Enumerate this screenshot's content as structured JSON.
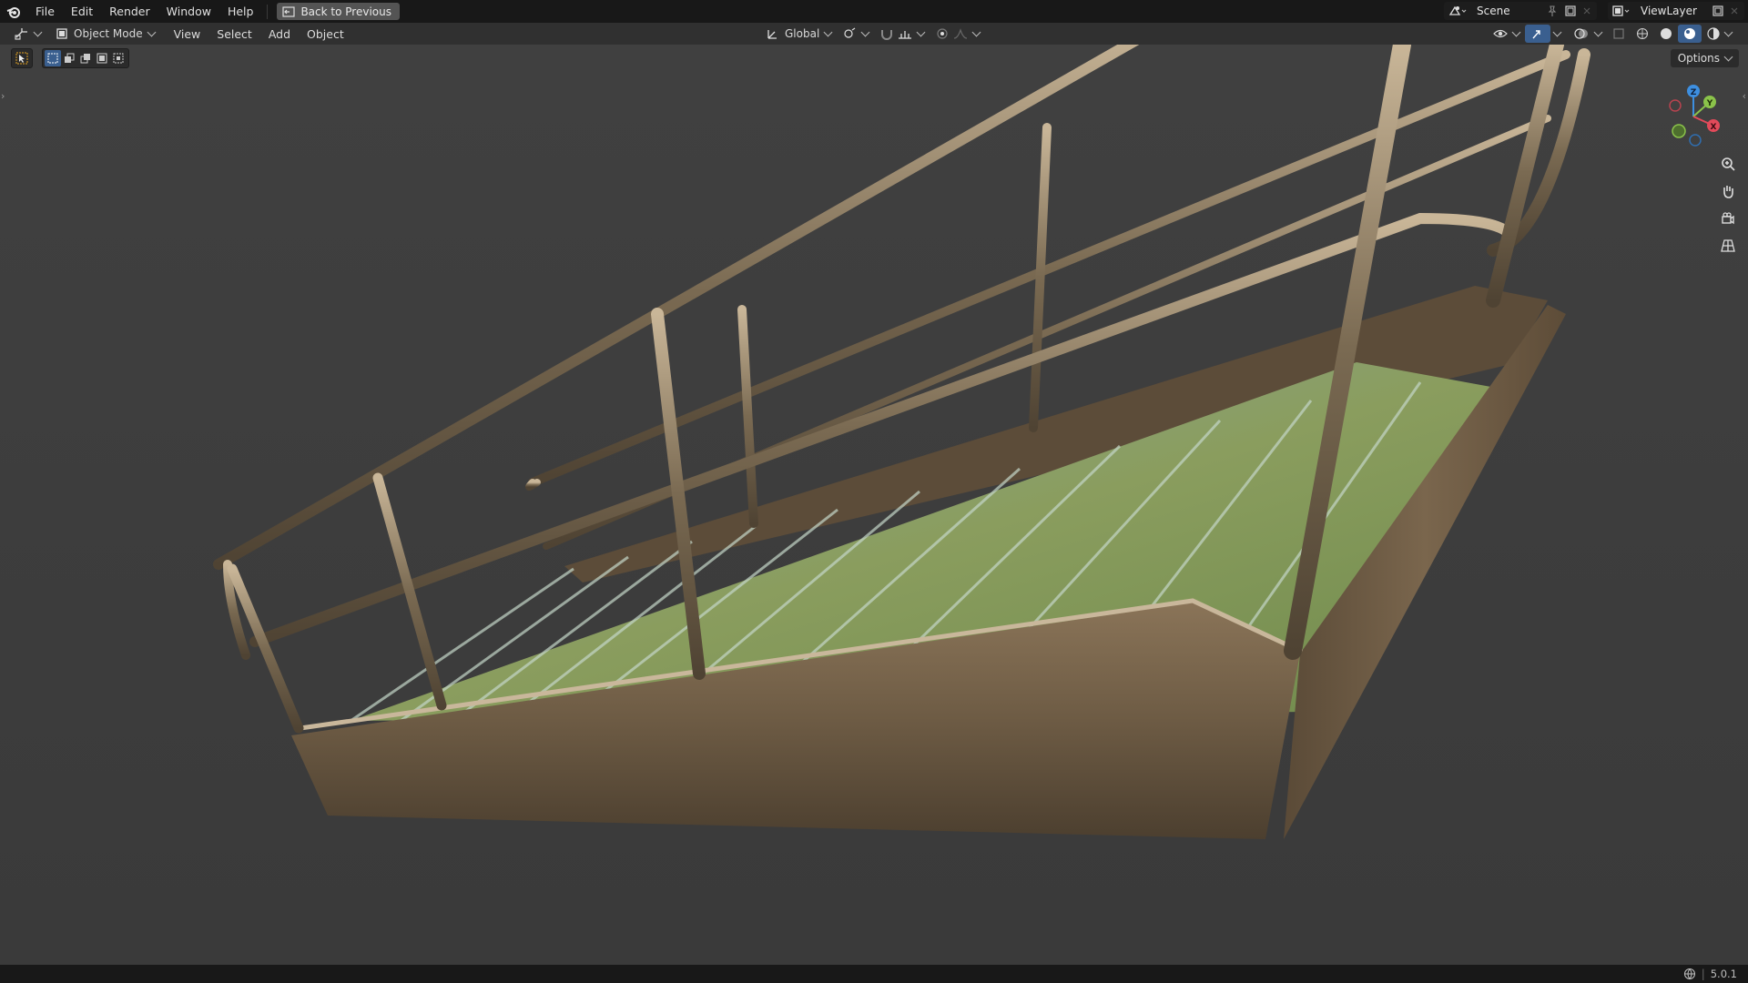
{
  "topbar": {
    "menus": [
      "File",
      "Edit",
      "Render",
      "Window",
      "Help"
    ],
    "back_label": "Back to Previous",
    "scene_label": "Scene",
    "viewlayer_label": "ViewLayer"
  },
  "header": {
    "editor_icon": "viewport-icon",
    "mode_label": "Object Mode",
    "menus": [
      "View",
      "Select",
      "Add",
      "Object"
    ],
    "orientation_label": "Global"
  },
  "viewport": {
    "options_label": "Options",
    "gizmo": {
      "x": "X",
      "y": "Y",
      "z": "Z",
      "x_color": "#e24a5a",
      "y_color": "#8bc34a",
      "z_color": "#3d8fe0"
    }
  },
  "status": {
    "version": "5.0.1"
  }
}
